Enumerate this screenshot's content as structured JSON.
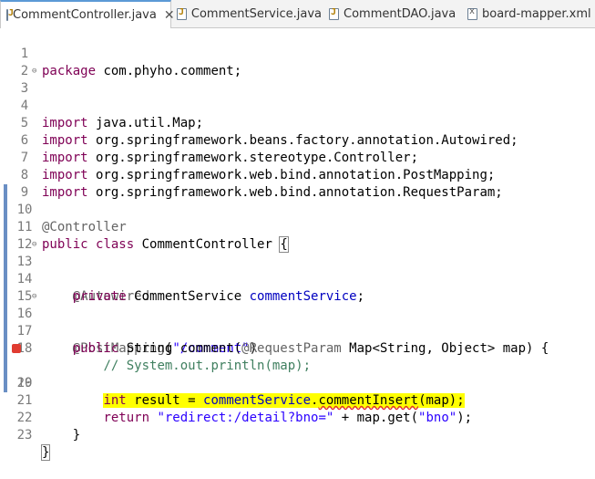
{
  "tabs": [
    {
      "label": "CommentController.java",
      "icon": "java-file-icon",
      "active": true,
      "close": "✕"
    },
    {
      "label": "CommentService.java",
      "icon": "java-file-icon",
      "active": false
    },
    {
      "label": "CommentDAO.java",
      "icon": "java-file-icon",
      "active": false
    },
    {
      "label": "board-mapper.xml",
      "icon": "xml-file-icon",
      "active": false
    }
  ],
  "editor": {
    "line_numbers": [
      "1",
      "2",
      "3",
      "4",
      "5",
      "6",
      "7",
      "8",
      "9",
      "10",
      "11",
      "12",
      "13",
      "14",
      "15",
      "16",
      "17",
      "18",
      "19",
      "20",
      "21",
      "22",
      "23"
    ],
    "fold_marker": "⊖",
    "lines": {
      "l1": {
        "kw": "package",
        "rest": " com.phyho.comment;"
      },
      "l3": {
        "kw": "import",
        "rest": " java.util.Map;"
      },
      "l5": {
        "kw": "import",
        "rest": " org.springframework.beans.factory.annotation.Autowired;"
      },
      "l6": {
        "kw": "import",
        "rest": " org.springframework.stereotype.Controller;"
      },
      "l7": {
        "kw": "import",
        "rest": " org.springframework.web.bind.annotation.PostMapping;"
      },
      "l8": {
        "kw": "import",
        "rest": " org.springframework.web.bind.annotation.RequestParam;"
      },
      "l10": {
        "ann": "@Controller"
      },
      "l11": {
        "kw1": "public",
        "kw2": "class",
        "rest": " CommentController ",
        "brace": "{"
      },
      "l13": {
        "ann": "@Autowired"
      },
      "l14": {
        "kw": "private",
        "rest": " CommentService ",
        "field": "commentService",
        "end": ";"
      },
      "l16": {
        "ann": "@PostMapping",
        "open": "(",
        "str": "\"/comment\"",
        "close": ")"
      },
      "l17": {
        "kw": "public",
        "a": " String comment(",
        "ann": "@RequestParam",
        "b": " Map<String, Object> map) {"
      },
      "l18": {
        "comment": "// System.out.println(map);"
      },
      "l19": {
        "kw": "int",
        "a": " result = ",
        "field": "commentService",
        "b": ".",
        "method": "commentInsert",
        "c": "(map);"
      },
      "l21": {
        "kw": "return",
        "sp": " ",
        "str": "\"redirect:/detail?bno=\"",
        "a": " + map.get(",
        "str2": "\"bno\"",
        "b": ");"
      },
      "l22": {
        "brace": "}"
      },
      "l23": {
        "brace": "}"
      }
    }
  },
  "colors": {
    "keyword": "#7f0055",
    "annotation": "#646464",
    "string": "#2a00ff",
    "field": "#0000c0",
    "comment": "#3f7f5f",
    "highlight": "#ffff00",
    "active_tab_accent": "#5c9ad6"
  }
}
